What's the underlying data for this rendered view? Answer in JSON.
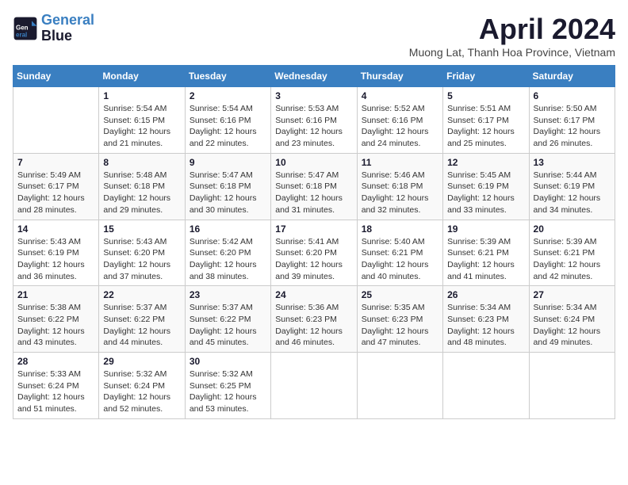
{
  "header": {
    "logo_line1": "General",
    "logo_line2": "Blue",
    "month_title": "April 2024",
    "location": "Muong Lat, Thanh Hoa Province, Vietnam"
  },
  "weekdays": [
    "Sunday",
    "Monday",
    "Tuesday",
    "Wednesday",
    "Thursday",
    "Friday",
    "Saturday"
  ],
  "weeks": [
    [
      {
        "day": "",
        "info": ""
      },
      {
        "day": "1",
        "info": "Sunrise: 5:54 AM\nSunset: 6:15 PM\nDaylight: 12 hours\nand 21 minutes."
      },
      {
        "day": "2",
        "info": "Sunrise: 5:54 AM\nSunset: 6:16 PM\nDaylight: 12 hours\nand 22 minutes."
      },
      {
        "day": "3",
        "info": "Sunrise: 5:53 AM\nSunset: 6:16 PM\nDaylight: 12 hours\nand 23 minutes."
      },
      {
        "day": "4",
        "info": "Sunrise: 5:52 AM\nSunset: 6:16 PM\nDaylight: 12 hours\nand 24 minutes."
      },
      {
        "day": "5",
        "info": "Sunrise: 5:51 AM\nSunset: 6:17 PM\nDaylight: 12 hours\nand 25 minutes."
      },
      {
        "day": "6",
        "info": "Sunrise: 5:50 AM\nSunset: 6:17 PM\nDaylight: 12 hours\nand 26 minutes."
      }
    ],
    [
      {
        "day": "7",
        "info": "Sunrise: 5:49 AM\nSunset: 6:17 PM\nDaylight: 12 hours\nand 28 minutes."
      },
      {
        "day": "8",
        "info": "Sunrise: 5:48 AM\nSunset: 6:18 PM\nDaylight: 12 hours\nand 29 minutes."
      },
      {
        "day": "9",
        "info": "Sunrise: 5:47 AM\nSunset: 6:18 PM\nDaylight: 12 hours\nand 30 minutes."
      },
      {
        "day": "10",
        "info": "Sunrise: 5:47 AM\nSunset: 6:18 PM\nDaylight: 12 hours\nand 31 minutes."
      },
      {
        "day": "11",
        "info": "Sunrise: 5:46 AM\nSunset: 6:18 PM\nDaylight: 12 hours\nand 32 minutes."
      },
      {
        "day": "12",
        "info": "Sunrise: 5:45 AM\nSunset: 6:19 PM\nDaylight: 12 hours\nand 33 minutes."
      },
      {
        "day": "13",
        "info": "Sunrise: 5:44 AM\nSunset: 6:19 PM\nDaylight: 12 hours\nand 34 minutes."
      }
    ],
    [
      {
        "day": "14",
        "info": "Sunrise: 5:43 AM\nSunset: 6:19 PM\nDaylight: 12 hours\nand 36 minutes."
      },
      {
        "day": "15",
        "info": "Sunrise: 5:43 AM\nSunset: 6:20 PM\nDaylight: 12 hours\nand 37 minutes."
      },
      {
        "day": "16",
        "info": "Sunrise: 5:42 AM\nSunset: 6:20 PM\nDaylight: 12 hours\nand 38 minutes."
      },
      {
        "day": "17",
        "info": "Sunrise: 5:41 AM\nSunset: 6:20 PM\nDaylight: 12 hours\nand 39 minutes."
      },
      {
        "day": "18",
        "info": "Sunrise: 5:40 AM\nSunset: 6:21 PM\nDaylight: 12 hours\nand 40 minutes."
      },
      {
        "day": "19",
        "info": "Sunrise: 5:39 AM\nSunset: 6:21 PM\nDaylight: 12 hours\nand 41 minutes."
      },
      {
        "day": "20",
        "info": "Sunrise: 5:39 AM\nSunset: 6:21 PM\nDaylight: 12 hours\nand 42 minutes."
      }
    ],
    [
      {
        "day": "21",
        "info": "Sunrise: 5:38 AM\nSunset: 6:22 PM\nDaylight: 12 hours\nand 43 minutes."
      },
      {
        "day": "22",
        "info": "Sunrise: 5:37 AM\nSunset: 6:22 PM\nDaylight: 12 hours\nand 44 minutes."
      },
      {
        "day": "23",
        "info": "Sunrise: 5:37 AM\nSunset: 6:22 PM\nDaylight: 12 hours\nand 45 minutes."
      },
      {
        "day": "24",
        "info": "Sunrise: 5:36 AM\nSunset: 6:23 PM\nDaylight: 12 hours\nand 46 minutes."
      },
      {
        "day": "25",
        "info": "Sunrise: 5:35 AM\nSunset: 6:23 PM\nDaylight: 12 hours\nand 47 minutes."
      },
      {
        "day": "26",
        "info": "Sunrise: 5:34 AM\nSunset: 6:23 PM\nDaylight: 12 hours\nand 48 minutes."
      },
      {
        "day": "27",
        "info": "Sunrise: 5:34 AM\nSunset: 6:24 PM\nDaylight: 12 hours\nand 49 minutes."
      }
    ],
    [
      {
        "day": "28",
        "info": "Sunrise: 5:33 AM\nSunset: 6:24 PM\nDaylight: 12 hours\nand 51 minutes."
      },
      {
        "day": "29",
        "info": "Sunrise: 5:32 AM\nSunset: 6:24 PM\nDaylight: 12 hours\nand 52 minutes."
      },
      {
        "day": "30",
        "info": "Sunrise: 5:32 AM\nSunset: 6:25 PM\nDaylight: 12 hours\nand 53 minutes."
      },
      {
        "day": "",
        "info": ""
      },
      {
        "day": "",
        "info": ""
      },
      {
        "day": "",
        "info": ""
      },
      {
        "day": "",
        "info": ""
      }
    ]
  ]
}
